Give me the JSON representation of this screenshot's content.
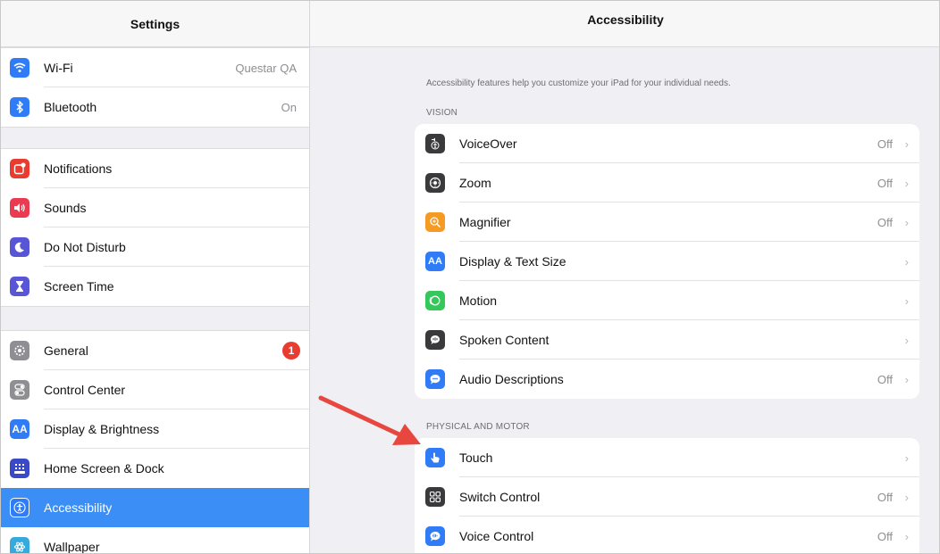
{
  "sidebar": {
    "title": "Settings",
    "groups": [
      {
        "items": [
          {
            "label": "Wi-Fi",
            "value": "Questar QA",
            "color": "#2f7cf6",
            "icon": "wifi-icon"
          },
          {
            "label": "Bluetooth",
            "value": "On",
            "color": "#2f7cf6",
            "icon": "bluetooth-icon"
          }
        ]
      },
      {
        "items": [
          {
            "label": "Notifications",
            "color": "#ea3b30",
            "icon": "notifications-icon"
          },
          {
            "label": "Sounds",
            "color": "#ea3b50",
            "icon": "sounds-icon"
          },
          {
            "label": "Do Not Disturb",
            "color": "#5856d6",
            "icon": "moon-icon"
          },
          {
            "label": "Screen Time",
            "color": "#5856d6",
            "icon": "hourglass-icon"
          }
        ]
      },
      {
        "items": [
          {
            "label": "General",
            "badge": "1",
            "color": "#8e8e93",
            "icon": "gear-icon"
          },
          {
            "label": "Control Center",
            "color": "#8e8e93",
            "icon": "toggles-icon"
          },
          {
            "label": "Display & Brightness",
            "color": "#2f7cf6",
            "icon": "text-size-icon",
            "glyph": "AA"
          },
          {
            "label": "Home Screen & Dock",
            "color": "#3a49c8",
            "icon": "grid-icon"
          },
          {
            "label": "Accessibility",
            "color": "#2f7cf6",
            "icon": "accessibility-icon",
            "selected": true
          },
          {
            "label": "Wallpaper",
            "color": "#35aadc",
            "icon": "wallpaper-icon"
          }
        ]
      }
    ]
  },
  "detail": {
    "title": "Accessibility",
    "description": "Accessibility features help you customize your iPad for your individual needs.",
    "sections": [
      {
        "header": "VISION",
        "items": [
          {
            "label": "VoiceOver",
            "value": "Off",
            "color": "#3a3a3c",
            "icon": "voiceover-icon"
          },
          {
            "label": "Zoom",
            "value": "Off",
            "color": "#3a3a3c",
            "icon": "zoom-icon"
          },
          {
            "label": "Magnifier",
            "value": "Off",
            "color": "#f59a23",
            "icon": "magnifier-icon"
          },
          {
            "label": "Display & Text Size",
            "value": "",
            "color": "#2f7cf6",
            "icon": "text-size-icon",
            "glyph": "AA"
          },
          {
            "label": "Motion",
            "value": "",
            "color": "#34c759",
            "icon": "motion-icon"
          },
          {
            "label": "Spoken Content",
            "value": "",
            "color": "#3a3a3c",
            "icon": "speech-bubble-icon"
          },
          {
            "label": "Audio Descriptions",
            "value": "Off",
            "color": "#2f7cf6",
            "icon": "audio-description-icon"
          }
        ]
      },
      {
        "header": "PHYSICAL AND MOTOR",
        "items": [
          {
            "label": "Touch",
            "value": "",
            "color": "#2f7cf6",
            "icon": "hand-pointer-icon"
          },
          {
            "label": "Switch Control",
            "value": "Off",
            "color": "#3a3a3c",
            "icon": "switch-control-icon"
          },
          {
            "label": "Voice Control",
            "value": "Off",
            "color": "#2f7cf6",
            "icon": "voice-control-icon"
          }
        ]
      }
    ]
  },
  "annotation": {
    "arrow_color": "#e8473f"
  }
}
